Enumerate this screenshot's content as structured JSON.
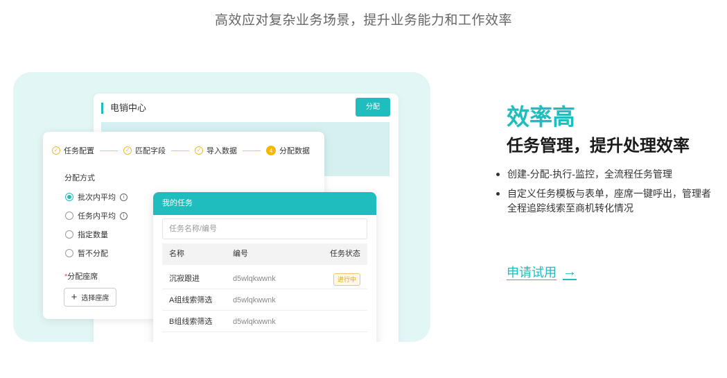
{
  "header": {
    "subtitle": "高效应对复杂业务场景，提升业务能力和工作效率"
  },
  "illustration": {
    "back_card": {
      "title": "电销中心",
      "assign_button": "分配"
    },
    "steps": [
      {
        "label": "任务配置",
        "icon": "✓"
      },
      {
        "label": "匹配字段",
        "icon": "✓"
      },
      {
        "label": "导入数据",
        "icon": "✓"
      },
      {
        "label": "分配数据",
        "icon": "4"
      }
    ],
    "assign_mode": {
      "label": "分配方式",
      "options": [
        {
          "label": "批次内平均",
          "checked": true,
          "info": "i"
        },
        {
          "label": "任务内平均",
          "checked": false,
          "info": "i"
        },
        {
          "label": "指定数量",
          "checked": false
        },
        {
          "label": "暂不分配",
          "checked": false
        }
      ]
    },
    "seat": {
      "required_mark": "*",
      "label": "分配座席",
      "button_plus": "+",
      "button_label": "选择座席"
    },
    "my_tasks": {
      "title": "我的任务",
      "search_placeholder": "任务名称/编号",
      "columns": [
        "名称",
        "编号",
        "任务状态"
      ],
      "rows": [
        {
          "name": "沉寂跟进",
          "id": "d5wlqkwwnk",
          "status": "进行中"
        },
        {
          "name": "A组线索筛选",
          "id": "d5wlqkwwnk",
          "status": ""
        },
        {
          "name": "B组线索筛选",
          "id": "d5wlqkwwnk",
          "status": ""
        }
      ]
    }
  },
  "feature": {
    "title": "效率高",
    "subtitle": "任务管理，提升处理效率",
    "bullets": [
      "创建-分配-执行-监控，全流程任务管理",
      "自定义任务模板与表单，座席一键呼出，管理者全程追踪线索至商机转化情况"
    ],
    "cta_label": "申请试用",
    "cta_arrow": "→"
  },
  "colors": {
    "accent": "#1fbdbd",
    "warning": "#f5b800",
    "panel_bg": "#e3f6f6"
  }
}
